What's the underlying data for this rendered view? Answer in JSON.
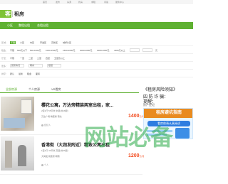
{
  "topbar": {
    "items": [
      "首页",
      "发布",
      "房源",
      "找房",
      "求租",
      "问答",
      "服务中心"
    ]
  },
  "header": {
    "logo_mark": "客",
    "section_title": "租房"
  },
  "nav": {
    "items": [
      "小区",
      "整租出租",
      "合租出租"
    ]
  },
  "filters": {
    "area": {
      "label": "区域：",
      "options": [
        "不限",
        "小区",
        "市区",
        "开发区",
        "高新区",
        "城郊片区"
      ]
    },
    "rent": {
      "label": "租金：",
      "options": [
        "不限",
        "500元以下",
        "500-1000元",
        "1000-1500元",
        "1500-2000元",
        "2000-3000元",
        "3000-4000元",
        "4000元以上"
      ],
      "custom_unit": "元"
    },
    "layout": {
      "label": "厅室：",
      "options": [
        "不限",
        "一室",
        "二室",
        "三室",
        "四室",
        "五室及以上"
      ]
    },
    "more": {
      "label": "更多：",
      "options": [
        "装修情况",
        "朝向",
        "楼层"
      ]
    },
    "sort": {
      "label": "排序：",
      "options": [
        "默认",
        "最新",
        "租金",
        "面积"
      ]
    }
  },
  "tabs": [
    "全部房源",
    "个人房源",
    "VR看房"
  ],
  "listings": [
    {
      "title": "樱花公寓，万达旁精装两室出租，家...",
      "meta1": "2室1厅  55平米  中层(共18层)",
      "meta2": "万达广场  精装修  南北",
      "price": "1400",
      "price_unit": "元/月",
      "person": "经纪人"
    },
    {
      "title": "香港街（大润发附近）精致公寓出租",
      "meta1": "1室1厅  40平米  高层(共26层)",
      "meta2": "大润发  简装修  朝南",
      "price": "1200",
      "price_unit": "元/月",
      "person": "个人"
    }
  ],
  "sidebar": {
    "title": "《租房风险须知》",
    "lines": [
      "四 防 诈 骗：",
      "提醒：",
      "房产经纪"
    ],
    "ad_head": "租房避坑指南",
    "ad_sub": "看房前请认真阅读"
  },
  "watermark": "网站必备"
}
